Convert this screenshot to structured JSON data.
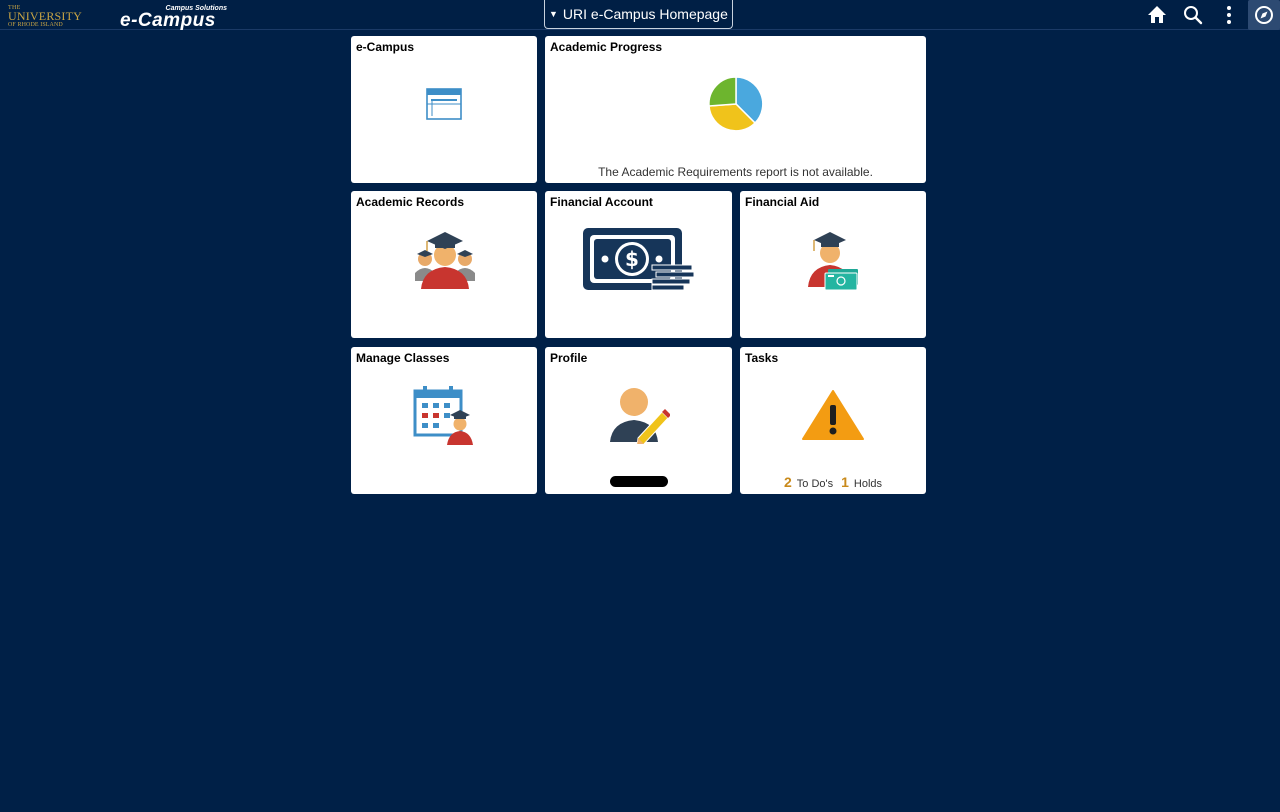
{
  "header": {
    "uri_logo": {
      "line1": "THE",
      "line2": "UNIVERSITY",
      "line3": "OF RHODE ISLAND"
    },
    "ecampus_logo": {
      "sub": "Campus Solutions",
      "main": "e-Campus"
    },
    "page_selector": "URI e-Campus Homepage",
    "buttons": [
      "home-icon",
      "search-icon",
      "more-options-icon",
      "navbar-icon"
    ]
  },
  "tiles": {
    "ecampus": {
      "title": "e-Campus"
    },
    "academic_progress": {
      "title": "Academic Progress",
      "message": "The Academic Requirements report is not available."
    },
    "academic_records": {
      "title": "Academic Records"
    },
    "financial_account": {
      "title": "Financial Account"
    },
    "financial_aid": {
      "title": "Financial Aid"
    },
    "manage_classes": {
      "title": "Manage Classes"
    },
    "profile": {
      "title": "Profile"
    },
    "tasks": {
      "title": "Tasks",
      "todos_count": "2",
      "todos_label": "To Do's",
      "holds_count": "1",
      "holds_label": "Holds"
    }
  },
  "colors": {
    "background": "#002047",
    "tile": "#ffffff",
    "accent_gold": "#c98a1b",
    "pie_blue": "#4aa8de",
    "pie_yellow": "#f0c31b",
    "pie_green": "#6db52e"
  }
}
